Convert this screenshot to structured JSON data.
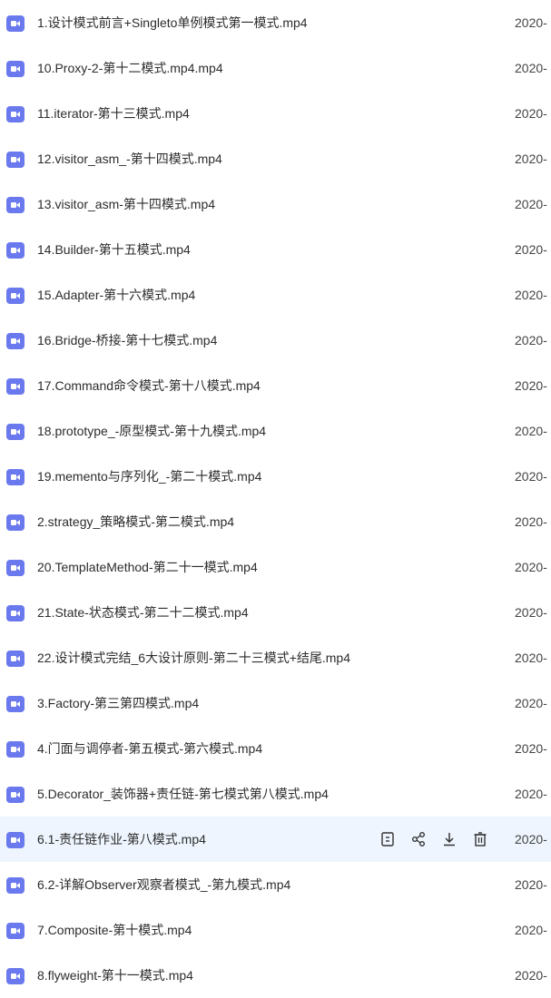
{
  "files": [
    {
      "name": "1.设计模式前言+Singleto单例模式第一模式.mp4",
      "date": "2020-",
      "icon": "video-file-icon"
    },
    {
      "name": "10.Proxy-2-第十二模式.mp4.mp4",
      "date": "2020-",
      "icon": "video-file-icon"
    },
    {
      "name": "11.iterator-第十三模式.mp4",
      "date": "2020-",
      "icon": "video-file-icon"
    },
    {
      "name": "12.visitor_asm_-第十四模式.mp4",
      "date": "2020-",
      "icon": "video-file-icon"
    },
    {
      "name": "13.visitor_asm-第十四模式.mp4",
      "date": "2020-",
      "icon": "video-file-icon"
    },
    {
      "name": "14.Builder-第十五模式.mp4",
      "date": "2020-",
      "icon": "video-file-icon"
    },
    {
      "name": "15.Adapter-第十六模式.mp4",
      "date": "2020-",
      "icon": "video-file-icon"
    },
    {
      "name": "16.Bridge-桥接-第十七模式.mp4",
      "date": "2020-",
      "icon": "video-file-icon"
    },
    {
      "name": "17.Command命令模式-第十八模式.mp4",
      "date": "2020-",
      "icon": "video-file-icon"
    },
    {
      "name": "18.prototype_-原型模式-第十九模式.mp4",
      "date": "2020-",
      "icon": "video-file-icon"
    },
    {
      "name": "19.memento与序列化_-第二十模式.mp4",
      "date": "2020-",
      "icon": "video-file-icon"
    },
    {
      "name": "2.strategy_策略模式-第二模式.mp4",
      "date": "2020-",
      "icon": "video-file-icon"
    },
    {
      "name": "20.TemplateMethod-第二十一模式.mp4",
      "date": "2020-",
      "icon": "video-file-icon"
    },
    {
      "name": "21.State-状态模式-第二十二模式.mp4",
      "date": "2020-",
      "icon": "video-file-icon"
    },
    {
      "name": "22.设计模式完结_6大设计原则-第二十三模式+结尾.mp4",
      "date": "2020-",
      "icon": "video-file-icon"
    },
    {
      "name": "3.Factory-第三第四模式.mp4",
      "date": "2020-",
      "icon": "video-file-icon"
    },
    {
      "name": "4.门面与调停者-第五模式-第六模式.mp4",
      "date": "2020-",
      "icon": "video-file-icon"
    },
    {
      "name": "5.Decorator_装饰器+责任链-第七模式第八模式.mp4",
      "date": "2020-",
      "icon": "video-file-icon"
    },
    {
      "name": "6.1-责任链作业-第八模式.mp4",
      "date": "2020-",
      "icon": "video-file-icon",
      "hovered": true
    },
    {
      "name": "6.2-详解Observer观察者模式_-第九模式.mp4",
      "date": "2020-",
      "icon": "video-file-icon"
    },
    {
      "name": "7.Composite-第十模式.mp4",
      "date": "2020-",
      "icon": "video-file-icon"
    },
    {
      "name": "8.flyweight-第十一模式.mp4",
      "date": "2020-",
      "icon": "video-file-icon"
    }
  ],
  "row_actions": [
    {
      "name": "details-icon"
    },
    {
      "name": "share-icon"
    },
    {
      "name": "download-icon"
    },
    {
      "name": "delete-icon"
    }
  ],
  "colors": {
    "icon_bg": "#6a79ee",
    "hover_bg": "#eef5fe",
    "text": "#2c2c2c",
    "action_icon": "#333333"
  }
}
